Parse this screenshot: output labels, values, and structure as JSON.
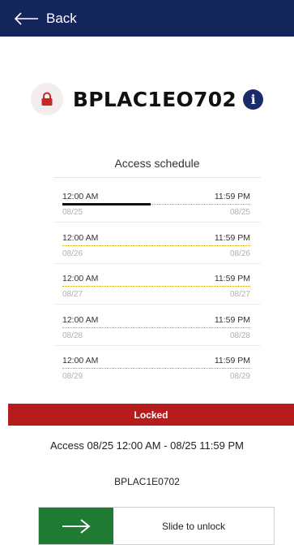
{
  "header": {
    "back_label": "Back"
  },
  "device": {
    "name": "BPLAC1EO702"
  },
  "schedule": {
    "title": "Access schedule",
    "slots": [
      {
        "start_time": "12:00 AM",
        "end_time": "11:59 PM",
        "start_date": "08/25",
        "end_date": "08/25",
        "elapsed_fraction": 0.47
      },
      {
        "start_time": "12:00 AM",
        "end_time": "11:59 PM",
        "start_date": "08/26",
        "end_date": "08/26",
        "elapsed_fraction": 0
      },
      {
        "start_time": "12:00 AM",
        "end_time": "11:59 PM",
        "start_date": "08/27",
        "end_date": "08/27",
        "elapsed_fraction": 0
      },
      {
        "start_time": "12:00 AM",
        "end_time": "11:59 PM",
        "start_date": "08/28",
        "end_date": "08/28",
        "elapsed_fraction": 0
      },
      {
        "start_time": "12:00 AM",
        "end_time": "11:59 PM",
        "start_date": "08/29",
        "end_date": "08/29",
        "elapsed_fraction": 0
      }
    ]
  },
  "status": {
    "label": "Locked",
    "color": "#b71c1c"
  },
  "access": {
    "text": "Access 08/25 12:00 AM - 08/25 11:59 PM"
  },
  "serial": "BPLAC1E0702",
  "slider": {
    "label": "Slide to unlock",
    "handle_color": "#1f7a33",
    "icon": "arrow-right-icon"
  },
  "icons": {
    "back": "arrow-left-icon",
    "lock": "padlock-icon",
    "info": "info-icon"
  },
  "colors": {
    "header_bg": "#13255a",
    "lock_icon": "#c62828"
  }
}
